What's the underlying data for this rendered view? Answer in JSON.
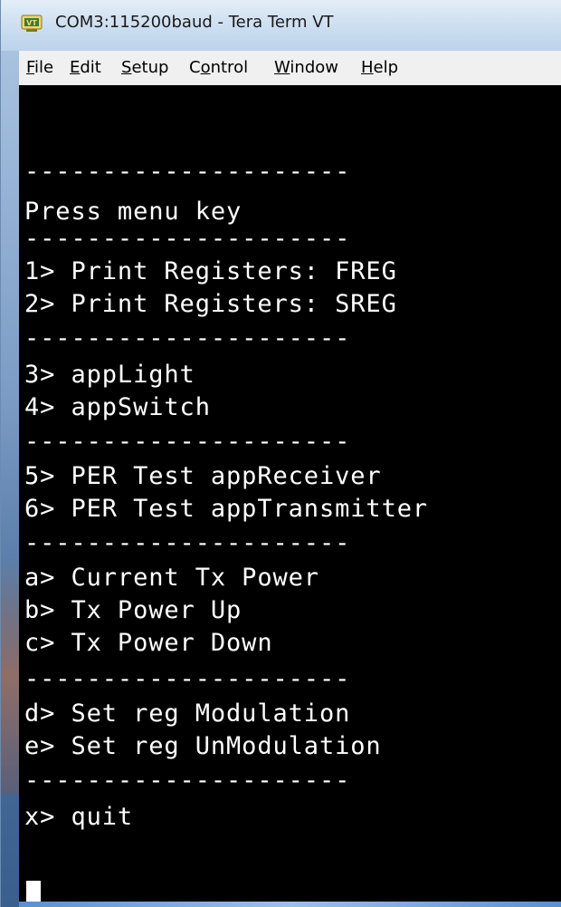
{
  "window": {
    "title": "COM3:115200baud - Tera Term VT",
    "icon": "tera-term-app-icon"
  },
  "menubar": {
    "items": [
      {
        "label": "File",
        "mnemonic_index": 0
      },
      {
        "label": "Edit",
        "mnemonic_index": 0
      },
      {
        "label": "Setup",
        "mnemonic_index": 0
      },
      {
        "label": "Control",
        "mnemonic_index": 1
      },
      {
        "label": "Window",
        "mnemonic_index": 0
      },
      {
        "label": "Help",
        "mnemonic_index": 0
      }
    ]
  },
  "terminal": {
    "background": "#000000",
    "foreground": "#ffffff",
    "lines": [
      "---------------------",
      "Press menu key",
      "---------------------",
      "1> Print Registers: FREG",
      "2> Print Registers: SREG",
      "---------------------",
      "3> appLight",
      "4> appSwitch",
      "---------------------",
      "5> PER Test appReceiver",
      "6> PER Test appTransmitter",
      "---------------------",
      "a> Current Tx Power",
      "b> Tx Power Up",
      "c> Tx Power Down",
      "---------------------",
      "d> Set reg Modulation",
      "e> Set reg UnModulation",
      "---------------------",
      "x> quit"
    ]
  }
}
